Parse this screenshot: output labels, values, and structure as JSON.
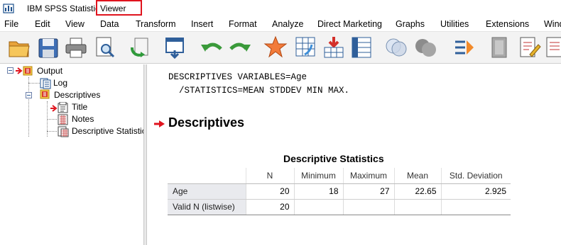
{
  "window": {
    "title_prefix": "IBM SPSS Statistics",
    "title_highlight": "Viewer"
  },
  "menu": {
    "items": [
      "File",
      "Edit",
      "View",
      "Data",
      "Transform",
      "Insert",
      "Format",
      "Analyze",
      "Direct Marketing",
      "Graphs",
      "Utilities",
      "Extensions",
      "Window"
    ]
  },
  "toolbar": {
    "icons": [
      "open-folder-icon",
      "save-icon",
      "print-icon",
      "print-preview-icon",
      "export-icon",
      "recall-dialog-icon",
      "undo-icon",
      "redo-icon",
      "goto-data-icon",
      "goto-case-icon",
      "goto-variable-icon",
      "variables-icon",
      "venn-icon",
      "gray-circles-icon",
      "designate-window-icon",
      "show-all-icon",
      "script-icon",
      "notes-icon"
    ]
  },
  "outline": {
    "root": "Output",
    "log": "Log",
    "section": "Descriptives",
    "children": [
      "Title",
      "Notes",
      "Descriptive Statistics"
    ]
  },
  "content": {
    "syntax_line1": "DESCRIPTIVES VARIABLES=Age",
    "syntax_line2": "  /STATISTICS=MEAN STDDEV MIN MAX.",
    "section_title": "Descriptives",
    "table": {
      "caption": "Descriptive Statistics",
      "headers": [
        "",
        "N",
        "Minimum",
        "Maximum",
        "Mean",
        "Std. Deviation"
      ],
      "rows": [
        [
          "Age",
          "20",
          "18",
          "27",
          "22.65",
          "2.925"
        ],
        [
          "Valid N (listwise)",
          "20",
          "",
          "",
          "",
          ""
        ]
      ]
    }
  },
  "colors": {
    "highlight_border": "#e0141e",
    "arrow_red": "#e0141e",
    "row_header_bg": "#e9eaee"
  }
}
